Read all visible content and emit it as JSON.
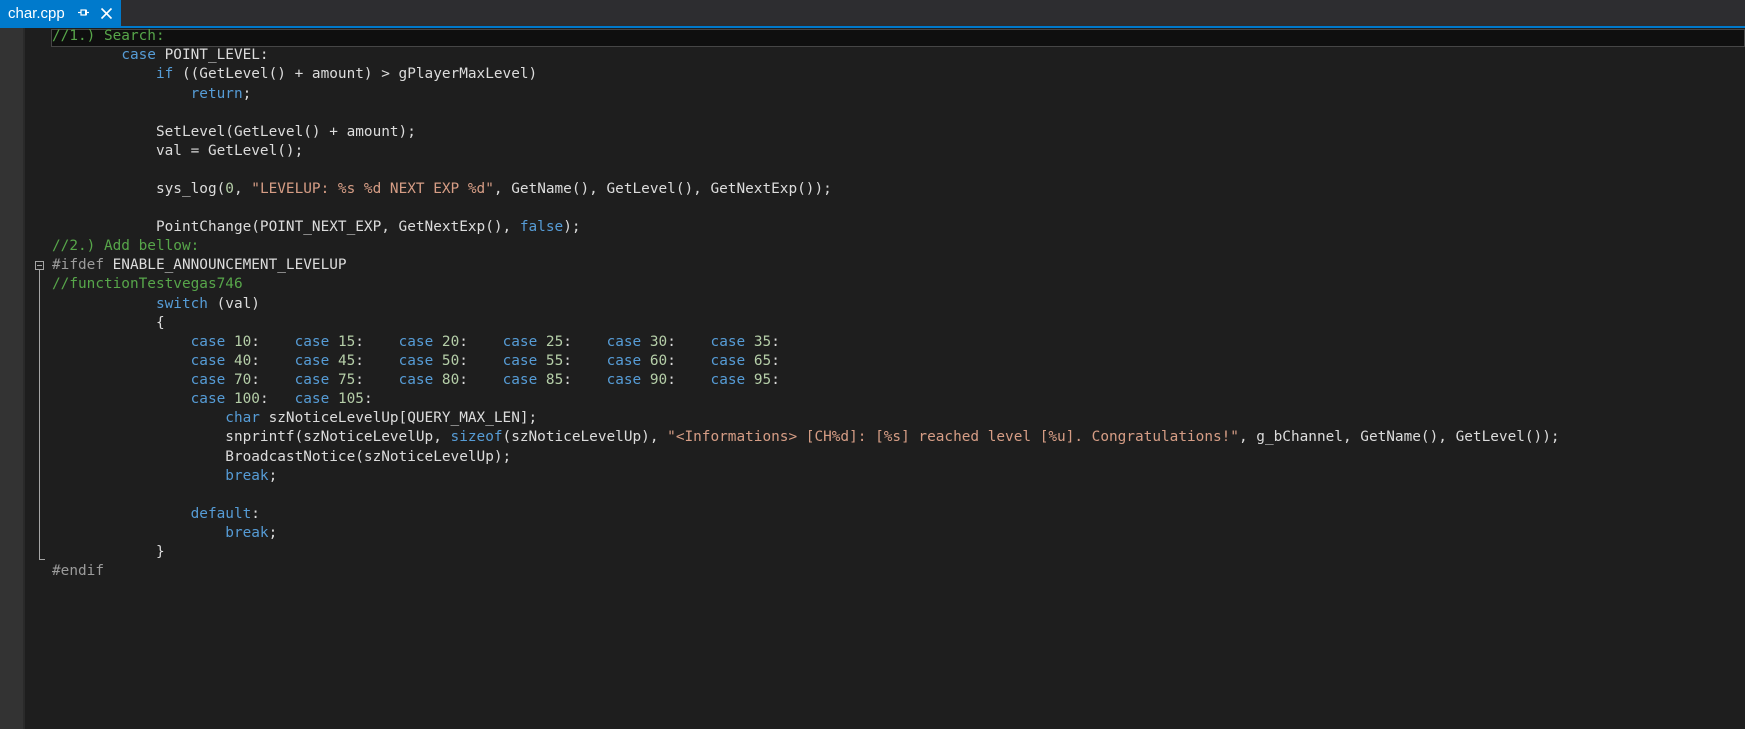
{
  "tab": {
    "title": "char.cpp",
    "pin_icon": "pin-icon",
    "close_icon": "close-icon"
  },
  "colors": {
    "accent": "#007acc",
    "background": "#1e1e1e",
    "comment": "#57a64a",
    "keyword": "#569cd6",
    "number": "#b5cea8",
    "string": "#d69d85",
    "text": "#dcdcdc",
    "preprocessor": "#9b9b9b"
  },
  "code": {
    "l1": "//1.) Search:",
    "l2_kw": "case",
    "l2_rest": " POINT_LEVEL:",
    "l3_kw": "if",
    "l3_rest": " ((GetLevel() + amount) > gPlayerMaxLevel)",
    "l4_kw": "return",
    "l4_rest": ";",
    "l6": "SetLevel(GetLevel() + amount);",
    "l7": "val = GetLevel();",
    "l9_a": "sys_log(",
    "l9_n": "0",
    "l9_b": ", ",
    "l9_s": "\"LEVELUP: %s %d NEXT EXP %d\"",
    "l9_c": ", GetName(), GetLevel(), GetNextExp());",
    "l11_a": "PointChange(POINT_NEXT_EXP, GetNextExp(), ",
    "l11_kw": "false",
    "l11_b": ");",
    "l12": "//2.) Add bellow:",
    "l13_pp": "#ifdef",
    "l13_rest": " ENABLE_ANNOUNCEMENT_LEVELUP",
    "l14": "//functionTestvegas746",
    "l15_kw": "switch",
    "l15_rest": " (val)",
    "l16": "{",
    "case_kw": "case",
    "cases_row1": [
      "10",
      "15",
      "20",
      "25",
      "30",
      "35"
    ],
    "cases_row2": [
      "40",
      "45",
      "50",
      "55",
      "60",
      "65"
    ],
    "cases_row3": [
      "70",
      "75",
      "80",
      "85",
      "90",
      "95"
    ],
    "cases_row4": [
      "100",
      "105"
    ],
    "l21_kw": "char",
    "l21_rest": " szNoticeLevelUp[QUERY_MAX_LEN];",
    "l22_a": "snprintf(szNoticeLevelUp, ",
    "l22_kw": "sizeof",
    "l22_b": "(szNoticeLevelUp), ",
    "l22_s": "\"<Informations> [CH%d]: [%s] reached level [%u]. Congratulations!\"",
    "l22_c": ", g_bChannel, GetName(), GetLevel());",
    "l23": "BroadcastNotice(szNoticeLevelUp);",
    "l24_kw": "break",
    "l24_rest": ";",
    "l26_kw": "default",
    "l26_rest": ":",
    "l27_kw": "break",
    "l27_rest": ";",
    "l28": "}",
    "l29": "#endif"
  }
}
